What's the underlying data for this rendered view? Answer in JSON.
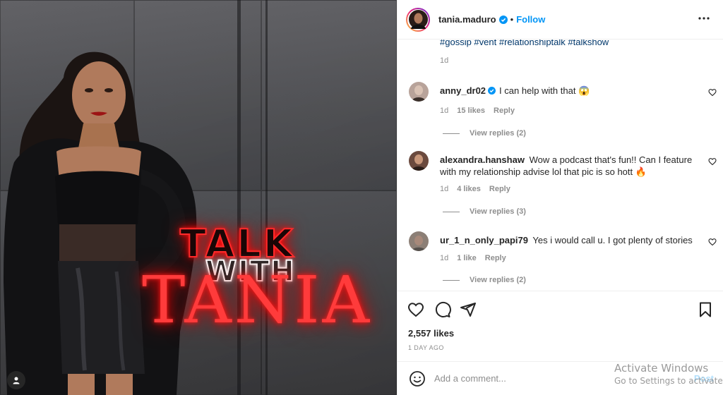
{
  "post": {
    "graphic": {
      "line1": "TALK",
      "line2": "WITH",
      "line3": "TANIA"
    }
  },
  "header": {
    "username": "tania.maduro",
    "separator": "•",
    "follow_label": "Follow"
  },
  "caption": {
    "tags": "#gossip #vent #relationshiptalk #talkshow",
    "time": "1d"
  },
  "comments": [
    {
      "username": "anny_dr02",
      "verified": true,
      "text": "I can help with that 😱",
      "time": "1d",
      "likes": "15 likes",
      "reply_label": "Reply",
      "view_replies": "View replies (2)",
      "avatar_color": "#b8a39a"
    },
    {
      "username": "alexandra.hanshaw",
      "verified": false,
      "text": "Wow a podcast that's fun!! Can I feature with my relationship advise lol that pic is so hott 🔥",
      "time": "1d",
      "likes": "4 likes",
      "reply_label": "Reply",
      "view_replies": "View replies (3)",
      "avatar_color": "#6b4a3e"
    },
    {
      "username": "ur_1_n_only_papi79",
      "verified": false,
      "text": "Yes i would call u. I got plenty of stories",
      "time": "1d",
      "likes": "1 like",
      "reply_label": "Reply",
      "view_replies": "View replies (2)",
      "avatar_color": "#8c7f76"
    }
  ],
  "actions": {
    "likes": "2,557 likes",
    "date": "1 DAY AGO"
  },
  "add_comment": {
    "placeholder": "Add a comment...",
    "post_label": "Post"
  },
  "watermark": {
    "line1": "Activate Windows",
    "line2": "Go to Settings to activate"
  },
  "icons": {
    "verified": "verified-badge-icon",
    "more": "more-options-icon",
    "heart": "heart-icon",
    "comment": "comment-icon",
    "share": "share-icon",
    "save": "bookmark-icon",
    "emoji": "emoji-icon",
    "user_tag": "user-tag-icon"
  },
  "colors": {
    "accent": "#0095f6",
    "neon_red": "#ff2a2a",
    "verified_blue": "#0095f6"
  }
}
